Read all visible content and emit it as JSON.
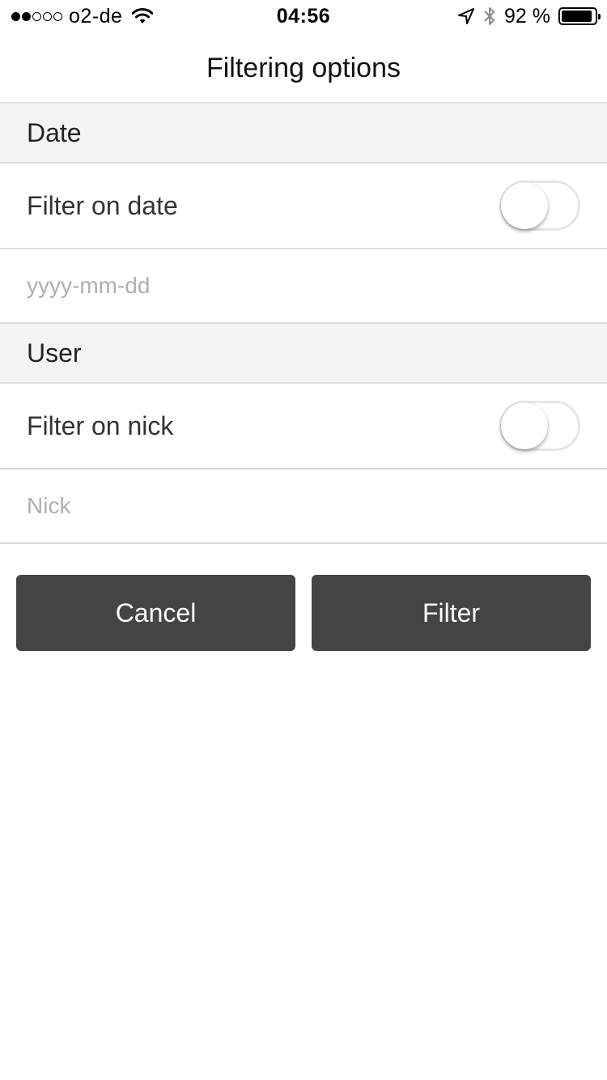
{
  "status_bar": {
    "carrier": "o2-de",
    "time": "04:56",
    "battery_percent": "92 %",
    "battery_level": 0.92,
    "signal_bars": 2,
    "signal_total": 5
  },
  "nav": {
    "title": "Filtering options"
  },
  "sections": {
    "date": {
      "header": "Date",
      "toggle_label": "Filter on date",
      "toggle_on": false,
      "input_value": "",
      "input_placeholder": "yyyy-mm-dd"
    },
    "user": {
      "header": "User",
      "toggle_label": "Filter on nick",
      "toggle_on": false,
      "input_value": "",
      "input_placeholder": "Nick"
    }
  },
  "buttons": {
    "cancel_label": "Cancel",
    "filter_label": "Filter"
  },
  "colors": {
    "button_bg": "#444444",
    "section_bg": "#f4f4f4",
    "divider": "#dcdcdc"
  },
  "icons": [
    "wifi-icon",
    "location-arrow-icon",
    "bluetooth-icon",
    "battery-icon"
  ]
}
